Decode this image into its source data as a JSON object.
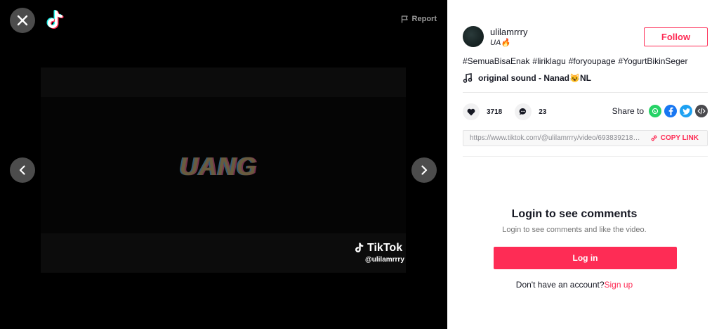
{
  "player": {
    "report_label": "Report",
    "video_text": "UANG",
    "watermark_brand": "TikTok",
    "watermark_user": "@ulilamrrry"
  },
  "author": {
    "username": "ulilamrrry",
    "nickname": "UA🔥",
    "follow_label": "Follow"
  },
  "hashtags": [
    "#SemuaBisaEnak",
    "#liriklagu",
    "#foryoupage",
    "#YogurtBikinSeger"
  ],
  "sound": {
    "title": "original sound - Nanad😺NL"
  },
  "stats": {
    "likes": "3718",
    "comments": "23"
  },
  "share": {
    "label": "Share to",
    "icons": [
      "whatsapp-icon",
      "facebook-icon",
      "twitter-icon",
      "embed-icon"
    ]
  },
  "link": {
    "url": "https://www.tiktok.com/@ulilamrrry/video/6938392182...",
    "copy_label": "COPY LINK"
  },
  "comments": {
    "title": "Login to see comments",
    "subtitle": "Login to see comments and like the video.",
    "login_label": "Log in",
    "signup_prompt": "Don't have an account?",
    "signup_label": "Sign up"
  },
  "colors": {
    "accent": "#fe2c55",
    "text": "#161823",
    "background_dark": "#000000"
  }
}
